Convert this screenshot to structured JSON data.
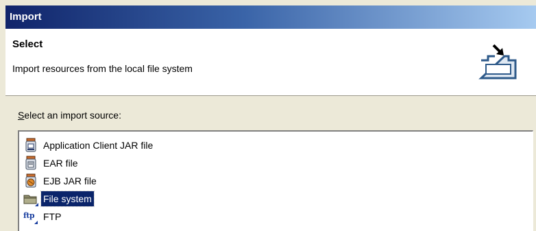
{
  "window": {
    "title": "Import"
  },
  "header": {
    "title": "Select",
    "description": "Import resources from the local file system",
    "icon": "import-banner-icon"
  },
  "source_label": {
    "mnemonic": "S",
    "rest": "elect an import source:"
  },
  "sources": [
    {
      "label": "Application Client JAR file",
      "icon": "app-client-jar-icon",
      "selected": false
    },
    {
      "label": "EAR file",
      "icon": "ear-file-icon",
      "selected": false
    },
    {
      "label": "EJB JAR file",
      "icon": "ejb-jar-icon",
      "selected": false
    },
    {
      "label": "File system",
      "icon": "folder-icon",
      "selected": true
    },
    {
      "label": "FTP",
      "icon": "ftp-icon",
      "selected": false
    }
  ],
  "ftp_icon_text": "ftp",
  "colors": {
    "title_dark": "#10246a",
    "title_light": "#a6caf0",
    "selection": "#0a246a",
    "dialog_bg": "#ece9d8"
  }
}
